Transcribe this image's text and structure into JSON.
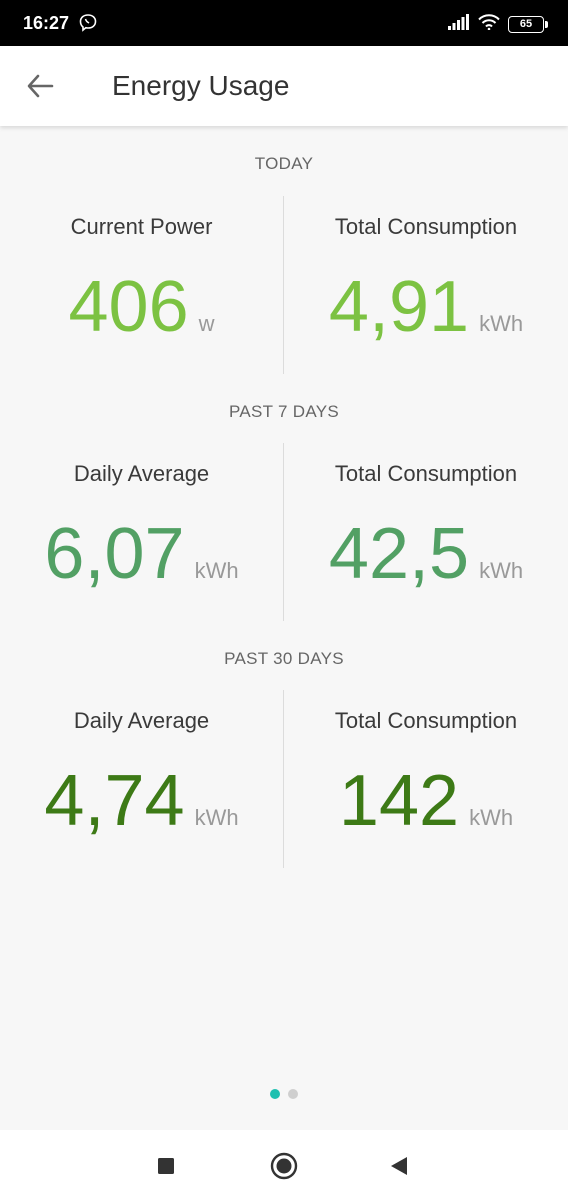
{
  "status_bar": {
    "time": "16:27",
    "battery": "65"
  },
  "app_bar": {
    "title": "Energy Usage"
  },
  "sections": [
    {
      "title": "TODAY",
      "left": {
        "label": "Current Power",
        "value": "406",
        "unit": "w"
      },
      "right": {
        "label": "Total Consumption",
        "value": "4,91",
        "unit": "kWh"
      }
    },
    {
      "title": "PAST 7 DAYS",
      "left": {
        "label": "Daily Average",
        "value": "6,07",
        "unit": "kWh"
      },
      "right": {
        "label": "Total Consumption",
        "value": "42,5",
        "unit": "kWh"
      }
    },
    {
      "title": "PAST 30 DAYS",
      "left": {
        "label": "Daily Average",
        "value": "4,74",
        "unit": "kWh"
      },
      "right": {
        "label": "Total Consumption",
        "value": "142",
        "unit": "kWh"
      }
    }
  ],
  "colors": {
    "today": "#7cc242",
    "past7": "#52a064",
    "past30": "#3d7a16",
    "dot_active": "#1ec0b0",
    "dot_inactive": "#cfcfcf"
  },
  "pager": {
    "pages": 2,
    "active": 0
  },
  "icons": {
    "back": "arrow-left-icon",
    "nav_recent": "square-icon",
    "nav_home": "circle-icon",
    "nav_back": "triangle-left-icon"
  }
}
